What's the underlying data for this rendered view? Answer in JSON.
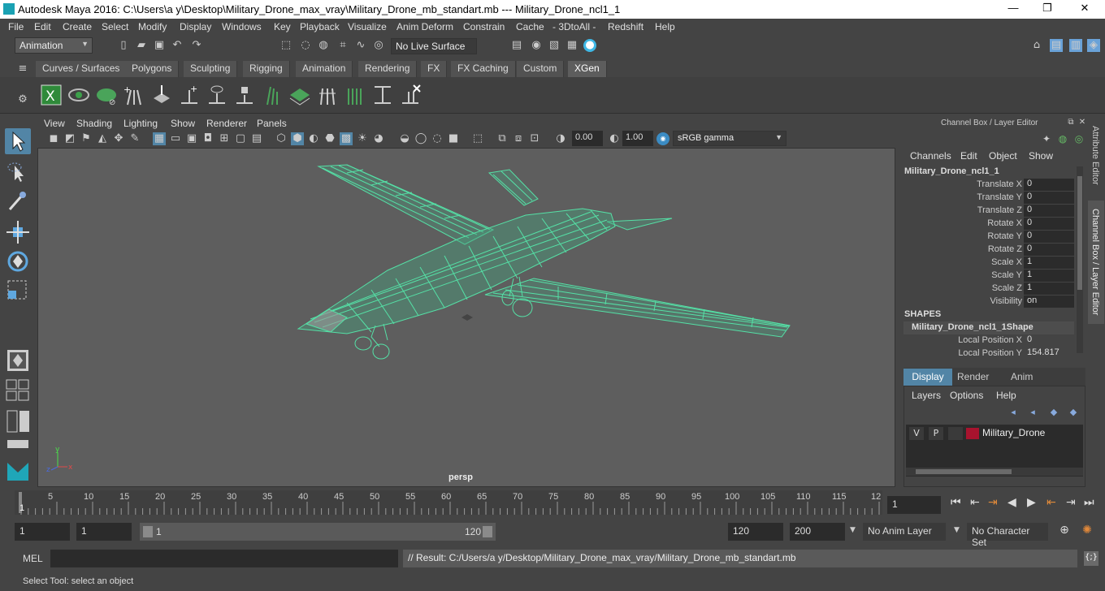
{
  "window": {
    "title": "Autodesk Maya 2016: C:\\Users\\a y\\Desktop\\Military_Drone_max_vray\\Military_Drone_mb_standart.mb   ---   Military_Drone_ncl1_1",
    "minimize": "—",
    "maximize": "❐",
    "close": "✕"
  },
  "menubar": [
    "File",
    "Edit",
    "Create",
    "Select",
    "Modify",
    "Display",
    "Windows",
    "Key",
    "Playback",
    "Visualize",
    "Anim Deform",
    "Constrain",
    "Cache",
    "- 3DtoAll -",
    "Redshift",
    "Help"
  ],
  "status": {
    "mode": "Animation",
    "live_surface": "No Live Surface"
  },
  "shelf_tabs": [
    "Curves / Surfaces",
    "Polygons",
    "Sculpting",
    "Rigging",
    "Animation",
    "Rendering",
    "FX",
    "FX Caching",
    "Custom",
    "XGen"
  ],
  "shelf_active": "XGen",
  "viewport": {
    "menu": [
      "View",
      "Shading",
      "Lighting",
      "Show",
      "Renderer",
      "Panels"
    ],
    "exposure": "0.00",
    "gamma": "1.00",
    "colorspace": "sRGB gamma",
    "camera": "persp",
    "wire_color": "#55e0a6"
  },
  "channel_box": {
    "header": "Channel Box / Layer Editor",
    "menu": [
      "Channels",
      "Edit",
      "Object",
      "Show"
    ],
    "object_name": "Military_Drone_ncl1_1",
    "attributes": [
      {
        "label": "Translate X",
        "value": "0"
      },
      {
        "label": "Translate Y",
        "value": "0"
      },
      {
        "label": "Translate Z",
        "value": "0"
      },
      {
        "label": "Rotate X",
        "value": "0"
      },
      {
        "label": "Rotate Y",
        "value": "0"
      },
      {
        "label": "Rotate Z",
        "value": "0"
      },
      {
        "label": "Scale X",
        "value": "1"
      },
      {
        "label": "Scale Y",
        "value": "1"
      },
      {
        "label": "Scale Z",
        "value": "1"
      },
      {
        "label": "Visibility",
        "value": "on"
      }
    ],
    "shapes_header": "SHAPES",
    "shape_name": "Military_Drone_ncl1_1Shape",
    "shape_attributes": [
      {
        "label": "Local Position X",
        "value": "0"
      },
      {
        "label": "Local Position Y",
        "value": "154.817"
      }
    ]
  },
  "layer_editor": {
    "tabs": [
      "Display",
      "Render",
      "Anim"
    ],
    "active_tab": "Display",
    "menu": [
      "Layers",
      "Options",
      "Help"
    ],
    "layer": {
      "v": "V",
      "p": "P",
      "name": "Military_Drone",
      "color": "#a8132e"
    }
  },
  "side_tabs": [
    "Attribute Editor",
    "Channel Box / Layer Editor"
  ],
  "timeline": {
    "ticks": [
      "5",
      "10",
      "15",
      "20",
      "25",
      "30",
      "35",
      "40",
      "45",
      "50",
      "55",
      "60",
      "65",
      "70",
      "75",
      "80",
      "85",
      "90",
      "95",
      "100",
      "105",
      "110",
      "115",
      "12"
    ],
    "current_frame_marker": "1",
    "current_frame": "1"
  },
  "range": {
    "start": "1",
    "playback_start": "1",
    "slider_start": "1",
    "slider_end": "120",
    "playback_end": "120",
    "end": "200",
    "anim_layer": "No Anim Layer",
    "character_set": "No Character Set"
  },
  "command": {
    "lang": "MEL",
    "result": "// Result: C:/Users/a y/Desktop/Military_Drone_max_vray/Military_Drone_mb_standart.mb"
  },
  "help_line": "Select Tool: select an object"
}
